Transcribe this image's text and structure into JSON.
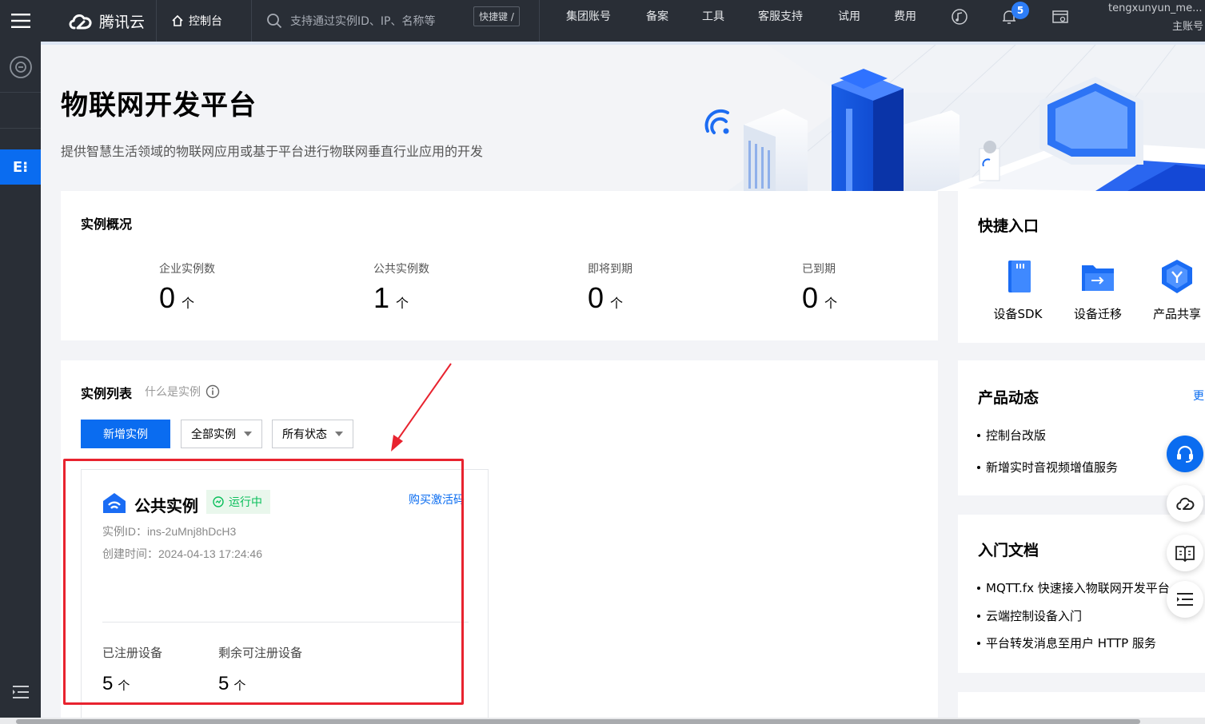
{
  "topbar": {
    "brand": "腾讯云",
    "console": "控制台",
    "search_placeholder": "支持通过实例ID、IP、名称等",
    "shortcut": "快捷键 /",
    "nav": [
      "集团账号",
      "备案",
      "工具",
      "客服支持",
      "试用",
      "费用"
    ],
    "notification_count": "5",
    "user_name": "tengxunyun_me...",
    "user_role": "主账号"
  },
  "sidebar": {
    "active_label": "E⁝"
  },
  "banner": {
    "title": "物联网开发平台",
    "subtitle": "提供智慧生活领域的物联网应用或基于平台进行物联网垂直行业应用的开发"
  },
  "overview": {
    "title": "实例概况",
    "stats": [
      {
        "label": "企业实例数",
        "value": "0",
        "unit": "个"
      },
      {
        "label": "公共实例数",
        "value": "1",
        "unit": "个"
      },
      {
        "label": "即将到期",
        "value": "0",
        "unit": "个"
      },
      {
        "label": "已到期",
        "value": "0",
        "unit": "个"
      }
    ]
  },
  "quick": {
    "title": "快捷入口",
    "items": [
      {
        "label": "设备SDK",
        "icon": "sdk-card-icon"
      },
      {
        "label": "设备迁移",
        "icon": "folder-transfer-icon"
      },
      {
        "label": "产品共享",
        "icon": "shield-share-icon"
      }
    ]
  },
  "instances": {
    "title": "实例列表",
    "help": "什么是实例",
    "new_button": "新增实例",
    "filter_type": "全部实例",
    "filter_status": "所有状态",
    "card": {
      "name": "公共实例",
      "status": "运行中",
      "buy_link": "购买激活码",
      "id_line": "实例ID：ins-2uMnj8hDcH3",
      "created_line": "创建时间：2024-04-13 17:24:46",
      "registered_label": "已注册设备",
      "registered_value": "5",
      "remaining_label": "剩余可注册设备",
      "remaining_value": "5",
      "unit": "个"
    }
  },
  "news": {
    "title": "产品动态",
    "more": "更",
    "items": [
      "控制台改版",
      "新增实时音视频增值服务"
    ]
  },
  "docs": {
    "title": "入门文档",
    "items": [
      "MQTT.fx 快速接入物联网开发平台",
      "云端控制设备入门",
      "平台转发消息至用户 HTTP 服务"
    ]
  },
  "colors": {
    "topbar": "#292e36",
    "brand_blue": "#0a6cf0",
    "running_green": "#0abf5b",
    "annotation_red": "#e8232f"
  }
}
